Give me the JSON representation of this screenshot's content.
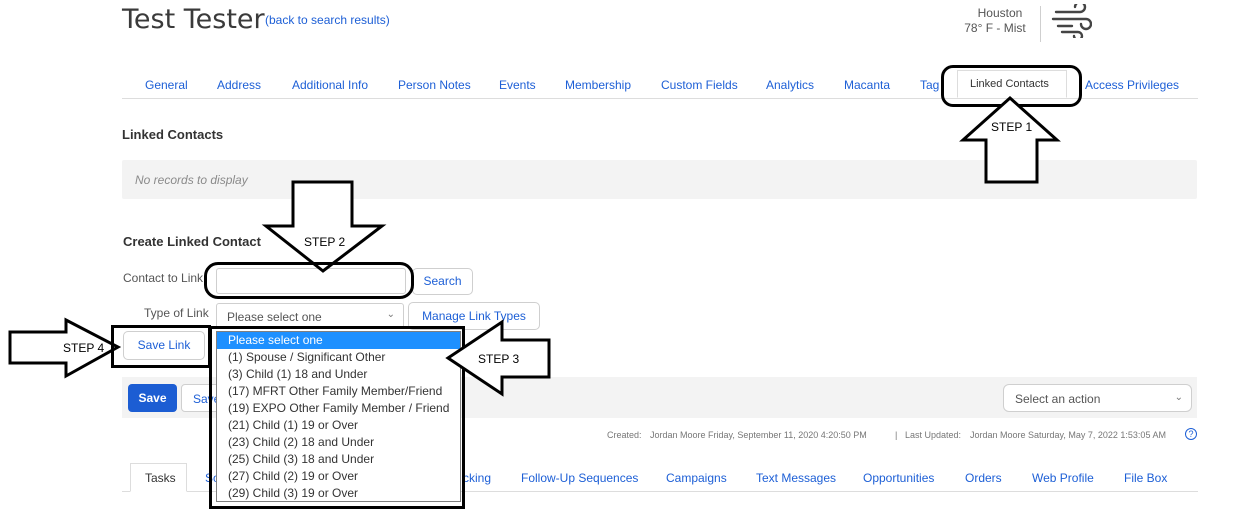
{
  "header": {
    "title": "Test Tester",
    "back_link": "(back to search results)",
    "weather": {
      "city": "Houston",
      "conditions": "78° F - Mist",
      "icon": "wind-icon"
    }
  },
  "tabs": {
    "general": "General",
    "address": "Address",
    "additional_info": "Additional Info",
    "person_notes": "Person Notes",
    "events": "Events",
    "membership": "Membership",
    "custom_fields": "Custom Fields",
    "analytics": "Analytics",
    "macanta": "Macanta",
    "tags": "Tag",
    "linked_contacts": "Linked Contacts",
    "access_privileges": "Access Privileges"
  },
  "linked_contacts": {
    "title": "Linked Contacts",
    "empty_text": "No records to display"
  },
  "create_linked": {
    "title": "Create Linked Contact",
    "contact_label": "Contact to Link",
    "contact_value": "",
    "search_button": "Search",
    "type_label": "Type of Link",
    "type_selected": "Please select one",
    "manage_button": "Manage Link Types",
    "save_link_button": "Save Link",
    "options": [
      "Please select one",
      "(1) Spouse / Significant Other",
      "(3) Child (1) 18 and Under",
      "(17) MFRT Other Family Member/Friend",
      "(19) EXPO Other Family Member / Friend",
      "(21) Child (1) 19 or Over",
      "(23) Child (2) 18 and Under",
      "(25) Child (3) 18 and Under",
      "(27) Child (2) 19 or Over",
      "(29) Child (3) 19 or Over"
    ]
  },
  "actions": {
    "save": "Save",
    "save_second": "Save",
    "select_action": "Select an action"
  },
  "meta": {
    "created_label": "Created:",
    "created_value": "Jordan Moore Friday, September 11, 2020 4:20:50 PM",
    "separator": "|",
    "updated_label": "Last Updated:",
    "updated_value": "Jordan Moore Saturday, May 7, 2022 1:53:05 AM",
    "help_glyph": "?"
  },
  "bottom_tabs": {
    "tasks": "Tasks",
    "so": "So",
    "tracking": "cking",
    "followup": "Follow-Up Sequences",
    "campaigns": "Campaigns",
    "text_messages": "Text Messages",
    "opportunities": "Opportunities",
    "orders": "Orders",
    "web_profile": "Web Profile",
    "file_box": "File Box"
  },
  "annotations": {
    "step1": "STEP 1",
    "step2": "STEP 2",
    "step3": "STEP 3",
    "step4": "STEP 4"
  },
  "colors": {
    "accent": "#1d5fd6",
    "primary_button": "#1c5dd3",
    "selected_option": "#1e90ff",
    "annotation": "#000000"
  }
}
